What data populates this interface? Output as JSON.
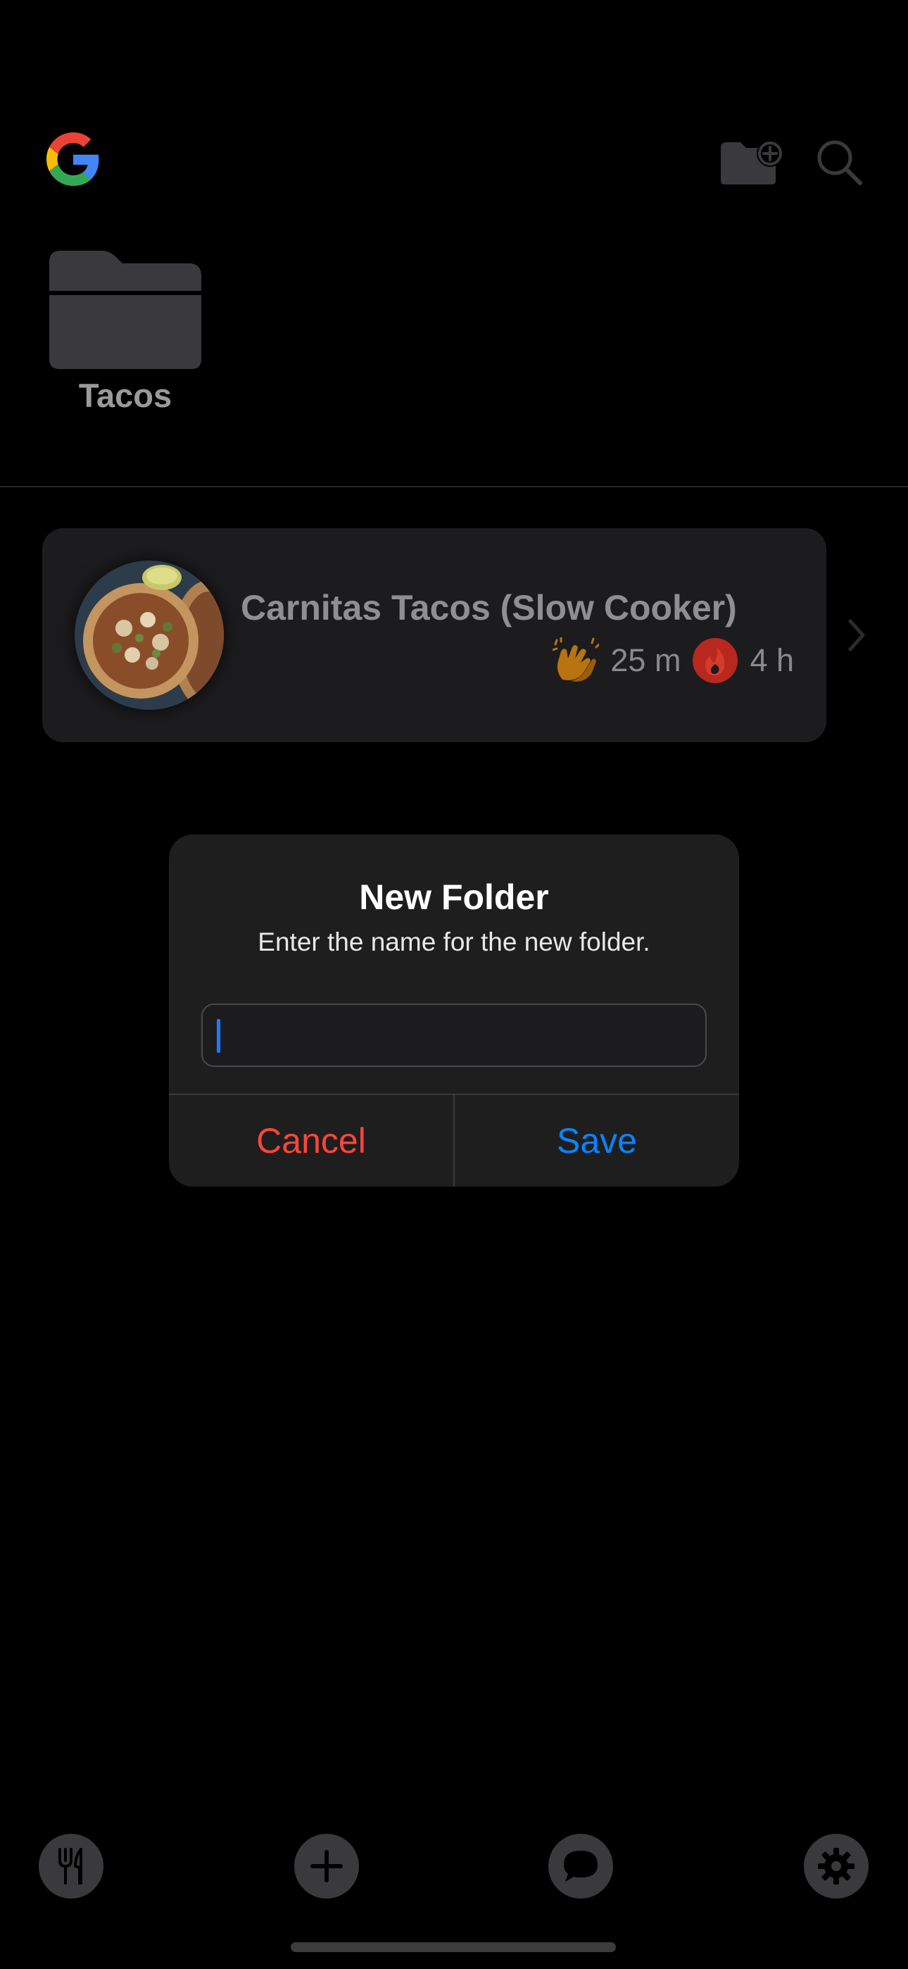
{
  "header": {
    "logo_icon": "google-logo-icon",
    "new_folder_icon": "folder-plus-icon",
    "search_icon": "search-icon"
  },
  "folders": [
    {
      "name": "Tacos",
      "icon": "folder-icon"
    }
  ],
  "recipes": [
    {
      "title": "Carnitas Tacos (Slow Cooker)",
      "prep_icon": "clapping-hands-icon",
      "prep_time": "25 m",
      "cook_icon": "fire-icon",
      "cook_time": "4 h"
    }
  ],
  "dialog": {
    "title": "New Folder",
    "message": "Enter the name for the new folder.",
    "input_value": "",
    "cancel_label": "Cancel",
    "save_label": "Save"
  },
  "bottom_nav": {
    "items": [
      {
        "icon": "fork-knife-icon"
      },
      {
        "icon": "plus-icon"
      },
      {
        "icon": "chat-bubble-icon"
      },
      {
        "icon": "gear-icon"
      }
    ]
  },
  "colors": {
    "background": "#000000",
    "dialog_bg": "#1e1e1f",
    "cancel": "#ff453a",
    "save": "#0a84ff",
    "prep_icon": "#b8740f",
    "cook_icon": "#b8281f"
  }
}
